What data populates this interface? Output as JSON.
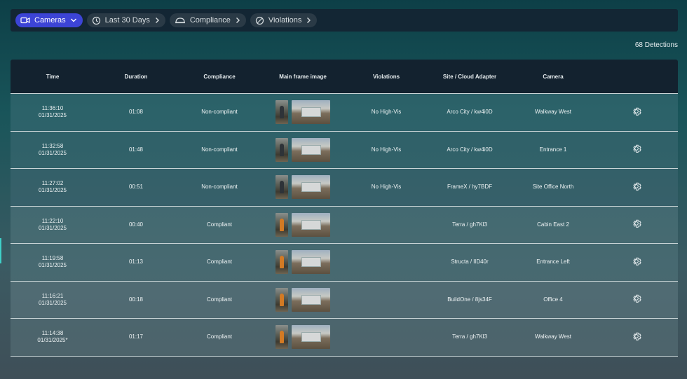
{
  "filters": [
    {
      "label": "Cameras",
      "icon": "camera-icon",
      "active": true,
      "caret": "chevron-down-icon"
    },
    {
      "label": "Last 30 Days",
      "icon": "history-icon",
      "active": false,
      "caret": "chevron-right-icon"
    },
    {
      "label": "Compliance",
      "icon": "hardhat-icon",
      "active": false,
      "caret": "chevron-right-icon"
    },
    {
      "label": "Violations",
      "icon": "prohibited-icon",
      "active": false,
      "caret": "chevron-right-icon"
    }
  ],
  "detections_count": "68 Detections",
  "columns": [
    "Time",
    "Duration",
    "Compliance",
    "Main frame image",
    "Violations",
    "Site / Cloud Adapter",
    "Camera"
  ],
  "rows": [
    {
      "time": "11:36:10",
      "date": "01/31/2025",
      "duration": "01:08",
      "compliance": "Non-compliant",
      "violations": "No High-Vis",
      "site": "Arco City / kw4i0D",
      "camera": "Walkway West",
      "vest": false
    },
    {
      "time": "11:32:58",
      "date": "01/31/2025",
      "duration": "01:48",
      "compliance": "Non-compliant",
      "violations": "No High-Vis",
      "site": "Arco City / kw4i0D",
      "camera": "Entrance 1",
      "vest": false
    },
    {
      "time": "11:27:02",
      "date": "01/31/2025",
      "duration": "00:51",
      "compliance": "Non-compliant",
      "violations": "No High-Vis",
      "site": "FrameX / hy7BDF",
      "camera": "Site Office North",
      "vest": false
    },
    {
      "time": "11:22:10",
      "date": "01/31/2025",
      "duration": "00:40",
      "compliance": "Compliant",
      "violations": "",
      "site": "Terra / gh7Kl3",
      "camera": "Cabin East 2",
      "vest": true
    },
    {
      "time": "11:19:58",
      "date": "01/31/2025",
      "duration": "01:13",
      "compliance": "Compliant",
      "violations": "",
      "site": "Structa / lID40r",
      "camera": "Entrance Left",
      "vest": true
    },
    {
      "time": "11:16:21",
      "date": "01/31/2025",
      "duration": "00:18",
      "compliance": "Compliant",
      "violations": "",
      "site": "BuildOne / 8js34F",
      "camera": "Office 4",
      "vest": true
    },
    {
      "time": "11:14:38",
      "date": "01/31/2025*",
      "duration": "01:17",
      "compliance": "Compliant",
      "violations": "",
      "site": "Terra / gh7Kl3",
      "camera": "Walkway West",
      "vest": true
    }
  ],
  "colors": {
    "active_chip": "#3c44d6",
    "header_bg": "#13222f",
    "accent": "#3fd0c8"
  }
}
